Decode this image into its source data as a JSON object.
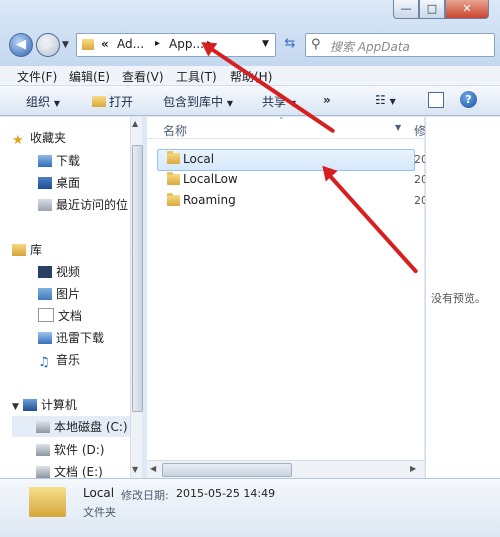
{
  "window": {
    "minimize_glyph": "—",
    "maximize_glyph": "□",
    "close_glyph": "✕"
  },
  "navigation": {
    "back_glyph": "◀",
    "forward_glyph": "▶",
    "refresh_glyph": "⇆",
    "address": {
      "overflow": "«",
      "crumbs": [
        "Ad...",
        "App..."
      ],
      "separator": "▸"
    },
    "search_placeholder": "搜索 AppData"
  },
  "menubar": [
    "文件(F)",
    "编辑(E)",
    "查看(V)",
    "工具(T)",
    "帮助(H)"
  ],
  "toolbar": {
    "organize": "组织",
    "open": "打开",
    "include_in_library": "包含到库中",
    "share": "共享",
    "more": "»"
  },
  "sidebar": {
    "favorites_header": "收藏夹",
    "favorites": [
      "下载",
      "桌面",
      "最近访问的位"
    ],
    "libraries_header": "库",
    "libraries": [
      "视频",
      "图片",
      "文档",
      "迅雷下载",
      "音乐"
    ],
    "computer_header": "计算机",
    "drives": [
      "本地磁盘 (C:)",
      "软件 (D:)",
      "文档 (E:)"
    ]
  },
  "filelist": {
    "column_name": "名称",
    "column_date": "修",
    "items": [
      {
        "name": "Local",
        "date": "20"
      },
      {
        "name": "LocalLow",
        "date": "20"
      },
      {
        "name": "Roaming",
        "date": "20"
      }
    ]
  },
  "preview": {
    "text": "没有预览。"
  },
  "details": {
    "name": "Local",
    "modified_label": "修改日期:",
    "modified_value": "2015-05-25 14:49",
    "type": "文件夹"
  },
  "colors": {
    "annotation_arrow": "#d71f1f",
    "selection": "#d6e8fc"
  }
}
